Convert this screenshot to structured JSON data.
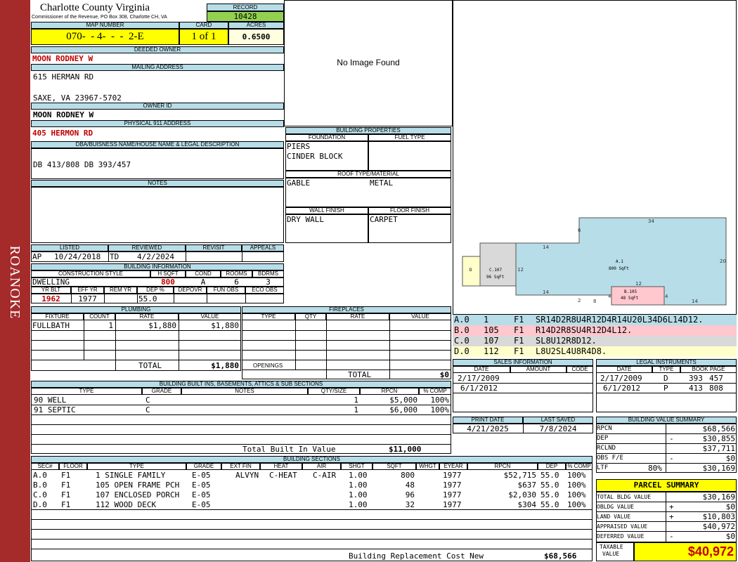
{
  "side_label": "ROANOKE",
  "header": {
    "county": "Charlotte County Virginia",
    "commissioner": "Commissioner of the Revenue, PO Box 308, Charlotte CH, VA",
    "record_label": "RECORD",
    "record": "10428",
    "map_label": "MAP NUMBER",
    "map_number": "070-  - 4-  -  -  2-E",
    "card_label": "CARD",
    "card": "1 of 1",
    "acres_label": "ACRES",
    "acres": "0.6500"
  },
  "owner": {
    "deeded_label": "DEEDED OWNER",
    "deeded": "MOON RODNEY W",
    "mailing_label": "MAILING ADDRESS",
    "mail1": "615 HERMAN RD",
    "mail2": "SAXE, VA 23967-5702",
    "owner_id_label": "OWNER ID",
    "owner_id": "MOON RODNEY W",
    "physical_label": "PHYSICAL 911 ADDRESS",
    "physical": "405 HERMON RD",
    "dba_label": "DBA/BUISNESS NAME/HOUSE NAME & LEGAL DESCRIPTION",
    "dba": "DB 413/808 DB 393/457",
    "notes_label": "NOTES"
  },
  "image": {
    "text": "No Image Found"
  },
  "bprops": {
    "title": "BUILDING PROPERTIES",
    "foundation_label": "FOUNDATION",
    "fuel_label": "FUEL TYPE",
    "foundation1": "PIERS",
    "foundation2": "CINDER BLOCK",
    "roof_label": "ROOF TYPE/MATERIAL",
    "roof_type": "GABLE",
    "roof_material": "METAL",
    "wall_label": "WALL FINISH",
    "floor_label": "FLOOR FINISH",
    "wall": "DRY WALL",
    "floor": "CARPET"
  },
  "listed": {
    "listed_label": "LISTED",
    "reviewed_label": "REVIEWED",
    "revisit_label": "REVISIT",
    "appeals_label": "APPEALS",
    "lister": "AP",
    "listed_date": "10/24/2018",
    "reviewer": "TD",
    "reviewed_date": "4/2/2024"
  },
  "binfo": {
    "title": "BUILDING INFORMATION",
    "style_label": "CONSTRUCTION STYLE",
    "hsqft_label": "H SQFT",
    "cond_label": "COND",
    "rooms_label": "ROOMS",
    "bdrms_label": "BDRMS",
    "style": "DWELLING",
    "hsqft": "800",
    "cond": "A",
    "rooms": "6",
    "bdrms": "3",
    "yrblt_label": "YR BLT",
    "effyr_label": "EFF YR",
    "remyr_label": "REM YR",
    "dep_label": "DEP %",
    "depovr_label": "DEPOVR",
    "funobs_label": "FUN OBS",
    "ecoobs_label": "ECO OBS",
    "yrblt": "1962",
    "effyr": "1977",
    "dep": "55.0"
  },
  "plumbing": {
    "title": "PLUMBING",
    "cols": [
      "FIXTURE",
      "COUNT",
      "RATE",
      "VALUE"
    ],
    "rows": [
      {
        "fixture": "FULLBATH",
        "count": "1",
        "rate": "$1,880",
        "value": "$1,880"
      }
    ],
    "total_label": "TOTAL",
    "total": "$1,880"
  },
  "fireplaces": {
    "title": "FIREPLACES",
    "cols": [
      "TYPE",
      "QTY",
      "RATE",
      "VALUE"
    ],
    "openings_label": "OPENINGS",
    "total_label": "TOTAL",
    "total": "$0"
  },
  "builtins": {
    "title": "BUILDING BUILT INS, BASEMENTS, ATTICS & SUB SECTIONS",
    "cols": [
      "TYPE",
      "GRADE",
      "NOTES",
      "QTY/SIZE",
      "RPCN",
      "% COMP"
    ],
    "rows": [
      {
        "type": "90 WELL",
        "grade": "C",
        "qty": "1",
        "rpcn": "$5,000",
        "comp": "100%"
      },
      {
        "type": "91 SEPTIC",
        "grade": "C",
        "qty": "1",
        "rpcn": "$6,000",
        "comp": "100%"
      }
    ],
    "total_label": "Total Built In Value",
    "total": "$11,000"
  },
  "sketch": {
    "labels": [
      {
        "id": "D",
        "t1": "D",
        "t2": ""
      },
      {
        "id": "C",
        "t1": "C.107",
        "t2": "96 SqFt"
      },
      {
        "id": "A",
        "t1": "A.1",
        "t2": "800 SqFt"
      },
      {
        "id": "B",
        "t1": "B.105",
        "t2": "48 SqFt"
      }
    ],
    "dims": [
      "34",
      "6",
      "14",
      "12",
      "20",
      "12",
      "14",
      "4",
      "4",
      "2",
      "8",
      "14"
    ]
  },
  "sketch_codes": [
    {
      "sec": "A.0",
      "num": "1",
      "floor": "F1",
      "code": "SR14D2R8U4R12D4R14U20L34D6L14D12.",
      "color": "#b7dde8"
    },
    {
      "sec": "B.0",
      "num": "105",
      "floor": "F1",
      "code": "R14D2R8SU4R12D4L12.",
      "color": "#ffc7ce"
    },
    {
      "sec": "C.0",
      "num": "107",
      "floor": "F1",
      "code": "SL8U12R8D12.",
      "color": "#d9d9d9"
    },
    {
      "sec": "D.0",
      "num": "112",
      "floor": "F1",
      "code": "L8U2SL4U8R4D8.",
      "color": "#ffffcc"
    }
  ],
  "sales": {
    "title": "SALES INFORMATION",
    "cols": [
      "DATE",
      "AMOUNT",
      "CODE"
    ],
    "rows": [
      {
        "date": "2/17/2009"
      },
      {
        "date": "6/1/2012"
      }
    ]
  },
  "legal": {
    "title": "LEGAL INSTRUMENTS",
    "cols": [
      "DATE",
      "TYPE",
      "BOOK PAGE"
    ],
    "rows": [
      {
        "date": "2/17/2009",
        "type": "D",
        "book": "393",
        "page": "457"
      },
      {
        "date": "6/1/2012",
        "type": "P",
        "book": "413",
        "page": "808"
      }
    ]
  },
  "dates": {
    "print_label": "PRINT DATE",
    "saved_label": "LAST SAVED",
    "print": "4/21/2025",
    "saved": "7/8/2024"
  },
  "bvs": {
    "title": "BUILDING VALUE SUMMARY",
    "rows": [
      {
        "label": "RPCN",
        "sign": "",
        "value": "$68,566"
      },
      {
        "label": "DEP",
        "sign": "-",
        "value": "$30,855"
      },
      {
        "label": "RCLND",
        "sign": "",
        "value": "$37,711"
      },
      {
        "label": "OBS F/E",
        "sign": "-",
        "value": "$0"
      },
      {
        "label": "LTF",
        "pct": "80%",
        "sign": "",
        "value": "$30,169"
      }
    ]
  },
  "parcel": {
    "title": "PARCEL SUMMARY",
    "rows": [
      {
        "label": "TOTAL BLDG VALUE",
        "sign": "",
        "value": "$30,169"
      },
      {
        "label": "OBLDG VALUE",
        "sign": "+",
        "value": "$0"
      },
      {
        "label": "LAND VALUE",
        "sign": "+",
        "value": "$10,803"
      },
      {
        "label": "APPRAISED VALUE",
        "sign": "",
        "value": "$40,972"
      },
      {
        "label": "DEFERRED VALUE",
        "sign": "-",
        "value": "$0"
      }
    ],
    "taxable_label1": "TAXABLE",
    "taxable_label2": "VALUE",
    "taxable": "$40,972"
  },
  "sections": {
    "title": "BUILDING SECTIONS",
    "cols": [
      "SEC#",
      "FLOOR",
      "TYPE",
      "GRADE",
      "EXT FIN",
      "HEAT",
      "AIR",
      "SHGT",
      "SQFT",
      "WHGT",
      "EYEAR",
      "RPCN",
      "DEP",
      "% COMP"
    ],
    "rows": [
      {
        "sec": "A.0",
        "floor": "F1",
        "type": "1 SINGLE FAMILY",
        "grade": "E-05",
        "extfin": "ALVYN",
        "heat": "C-HEAT",
        "air": "C-AIR",
        "shgt": "1.00",
        "sqft": "800",
        "eyear": "1977",
        "rpcn": "$52,715",
        "dep": "55.0",
        "comp": "100%"
      },
      {
        "sec": "B.0",
        "floor": "F1",
        "type": "105 OPEN FRAME PCH",
        "grade": "E-05",
        "extfin": "",
        "heat": "",
        "air": "",
        "shgt": "1.00",
        "sqft": "48",
        "eyear": "1977",
        "rpcn": "$637",
        "dep": "55.0",
        "comp": "100%"
      },
      {
        "sec": "C.0",
        "floor": "F1",
        "type": "107 ENCLOSED PORCH",
        "grade": "E-05",
        "extfin": "",
        "heat": "",
        "air": "",
        "shgt": "1.00",
        "sqft": "96",
        "eyear": "1977",
        "rpcn": "$2,030",
        "dep": "55.0",
        "comp": "100%"
      },
      {
        "sec": "D.0",
        "floor": "F1",
        "type": "112 WOOD DECK",
        "grade": "E-05",
        "extfin": "",
        "heat": "",
        "air": "",
        "shgt": "1.00",
        "sqft": "32",
        "eyear": "1977",
        "rpcn": "$304",
        "dep": "55.0",
        "comp": "100%"
      }
    ],
    "total_label": "Building Replacement Cost New",
    "total": "$68,566"
  }
}
